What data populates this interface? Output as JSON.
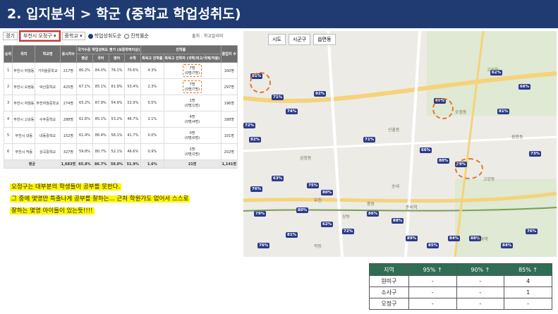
{
  "title": "2. 입지분석 > 학군 (중학교 학업성취도)",
  "filter": {
    "region": "경기",
    "district": "부천시 오정구",
    "level": "중학교",
    "radio_achievement": "학업성취도순",
    "radio_advance": "진학률순",
    "source": "출처 : 학교알리미"
  },
  "table": {
    "group_header": "국가수준 학업성취도 평가 (보통학력이상)",
    "advance_group": "진학률",
    "headers": [
      "순위",
      "위치",
      "학교명",
      "응시자수",
      "평균",
      "국어",
      "영어",
      "수학",
      "특목고 진학률",
      "특목고 진학자 (과학/외고/국제/자율)",
      "졸업자 수"
    ],
    "rows": [
      [
        "1",
        "부천시 여월동",
        "가치울중학교",
        "217명",
        "80.2%",
        "84.0%",
        "76.1%",
        "70.6%",
        "4.3%",
        "7명\n(0명/7명)",
        "160명"
      ],
      [
        "2",
        "부천시 오정동",
        "덕산중학교",
        "425명",
        "67.1%",
        "85.1%",
        "61.9%",
        "53.4%",
        "2.3%",
        "7명\n(0명/7명)",
        "297명"
      ],
      [
        "3",
        "부천시 여월동",
        "부천여월중학교",
        "274명",
        "65.2%",
        "87.9%",
        "54.9%",
        "52.9%",
        "0.5%",
        "1명\n(0명/1명)",
        "196명"
      ],
      [
        "4",
        "부천시 고강동",
        "수주중학교",
        "288명",
        "61.6%",
        "85.1%",
        "53.2%",
        "46.7%",
        "2.1%",
        "4명\n(0명/4명)",
        "188명"
      ],
      [
        "5",
        "부천시 내동",
        "내동중학교",
        "152명",
        "61.4%",
        "86.4%",
        "56.1%",
        "41.7%",
        "0.0%",
        "0명\n(0명/0명)",
        "101명"
      ],
      [
        "6",
        "부천시 작동",
        "성곡중학교",
        "327명",
        "59.8%",
        "80.7%",
        "52.1%",
        "46.6%",
        "0.9%",
        "2명\n(0명/2명)",
        "202명"
      ]
    ],
    "total": [
      "평균",
      "1,683명",
      "65.8%",
      "86.7%",
      "59.0%",
      "51.9%",
      "1.6%",
      "21명",
      "1,141명"
    ]
  },
  "note": [
    "오정구는 대부분의 학생들이 공부를 못한다.",
    "그 중에 몇명만 특출나게 공부를 잘하는... 근처 학원가도 없어서 스스로",
    "잘하는 몇명 아이들이 있는듯!!!!"
  ],
  "map": {
    "controls": [
      "시도",
      "시군구",
      "읍면동"
    ],
    "pins": [
      "81%",
      "71%",
      "92%",
      "74%",
      "72%",
      "92%",
      "67%",
      "62%",
      "81%",
      "66%",
      "80%",
      "79%",
      "66%",
      "71%",
      "63%",
      "76%",
      "75%",
      "80%",
      "80%",
      "79%",
      "62%",
      "72%",
      "86%",
      "88%",
      "89%",
      "85%",
      "84%",
      "88%",
      "84%",
      "76%",
      "73%",
      "81%",
      "76%"
    ],
    "labels": [
      "신흥동",
      "원종동",
      "고강동",
      "오정동",
      "삼정동",
      "부천",
      "송내",
      "중동",
      "상동",
      "춘의역",
      "역곡역",
      "작동",
      "고리울"
    ]
  },
  "summary": {
    "headers": [
      "지역",
      "95% ↑",
      "90% ↑",
      "85% ↑"
    ],
    "rows": [
      [
        "원미구",
        "-",
        "-",
        "4"
      ],
      [
        "소사구",
        "-",
        "-",
        "1"
      ],
      [
        "오정구",
        "-",
        "-",
        "-"
      ]
    ]
  }
}
